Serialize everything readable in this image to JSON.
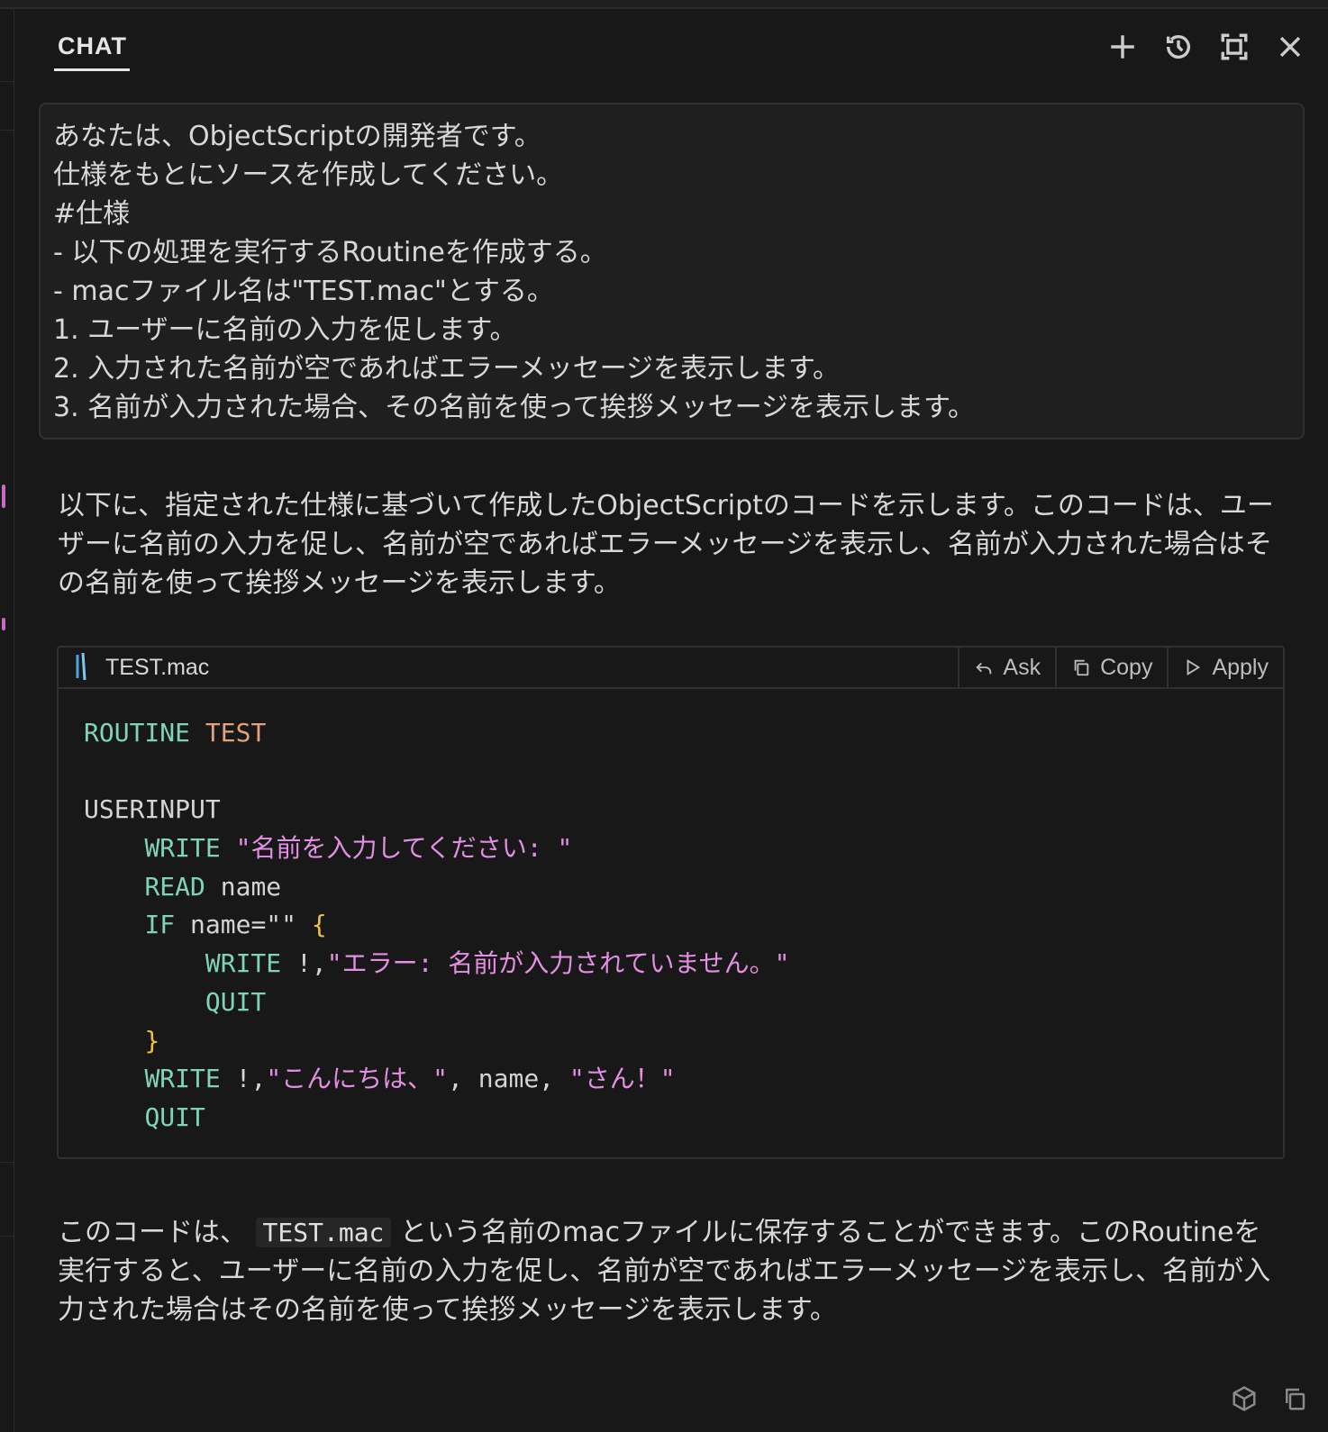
{
  "header": {
    "tab_label": "CHAT",
    "actions": [
      "plus-icon",
      "history-icon",
      "maximize-icon",
      "close-icon"
    ]
  },
  "prompt": {
    "lines": [
      "あなたは、ObjectScriptの開発者です。",
      "仕様をもとにソースを作成してください。",
      "#仕様",
      "- 以下の処理を実行するRoutineを作成する。",
      "- macファイル名は\"TEST.mac\"とする。",
      "1. ユーザーに名前の入力を促します。",
      "2. 入力された名前が空であればエラーメッセージを表示します。",
      "3. 名前が入力された場合、その名前を使って挨拶メッセージを表示します。"
    ]
  },
  "response": {
    "intro": "以下に、指定された仕様に基づいて作成したObjectScriptのコードを示します。このコードは、ユーザーに名前の入力を促し、名前が空であればエラーメッセージを表示し、名前が入力された場合はその名前を使って挨拶メッセージを表示します。",
    "outro_before": "このコードは、",
    "outro_code": "TEST.mac",
    "outro_after": "という名前のmacファイルに保存することができます。このRoutineを実行すると、ユーザーに名前の入力を促し、名前が空であればエラーメッセージを表示し、名前が入力された場合はその名前を使って挨拶メッセージを表示します。"
  },
  "code_block": {
    "file_name": "TEST.mac",
    "ask_label": "Ask",
    "copy_label": "Copy",
    "apply_label": "Apply",
    "lines": [
      [
        {
          "t": "kw",
          "v": "ROUTINE"
        },
        {
          "t": "plain",
          "v": " "
        },
        {
          "t": "nm",
          "v": "TEST"
        }
      ],
      [],
      [
        {
          "t": "plain",
          "v": "USERINPUT"
        }
      ],
      [
        {
          "t": "plain",
          "v": "    "
        },
        {
          "t": "kw",
          "v": "WRITE"
        },
        {
          "t": "plain",
          "v": " "
        },
        {
          "t": "str",
          "v": "\"名前を入力してください: \""
        }
      ],
      [
        {
          "t": "plain",
          "v": "    "
        },
        {
          "t": "kw",
          "v": "READ"
        },
        {
          "t": "plain",
          "v": " name"
        }
      ],
      [
        {
          "t": "plain",
          "v": "    "
        },
        {
          "t": "kw",
          "v": "IF"
        },
        {
          "t": "plain",
          "v": " name=\"\" "
        },
        {
          "t": "brace",
          "v": "{"
        }
      ],
      [
        {
          "t": "plain",
          "v": "        "
        },
        {
          "t": "kw",
          "v": "WRITE"
        },
        {
          "t": "plain",
          "v": " !,"
        },
        {
          "t": "str",
          "v": "\"エラー: 名前が入力されていません。\""
        }
      ],
      [
        {
          "t": "plain",
          "v": "        "
        },
        {
          "t": "kw",
          "v": "QUIT"
        }
      ],
      [
        {
          "t": "plain",
          "v": "    "
        },
        {
          "t": "brace",
          "v": "}"
        }
      ],
      [
        {
          "t": "plain",
          "v": "    "
        },
        {
          "t": "kw",
          "v": "WRITE"
        },
        {
          "t": "plain",
          "v": " !,"
        },
        {
          "t": "str",
          "v": "\"こんにちは、\""
        },
        {
          "t": "plain",
          "v": ", name, "
        },
        {
          "t": "str",
          "v": "\"さん！\""
        }
      ],
      [
        {
          "t": "plain",
          "v": "    "
        },
        {
          "t": "kw",
          "v": "QUIT"
        }
      ]
    ]
  },
  "footer_actions": [
    "cube-icon",
    "copy-icon"
  ],
  "colors": {
    "background": "#181818",
    "keyword": "#7fd4b8",
    "routine_name": "#e2a37a",
    "string": "#e38fe3",
    "brace": "#f0c23a"
  }
}
